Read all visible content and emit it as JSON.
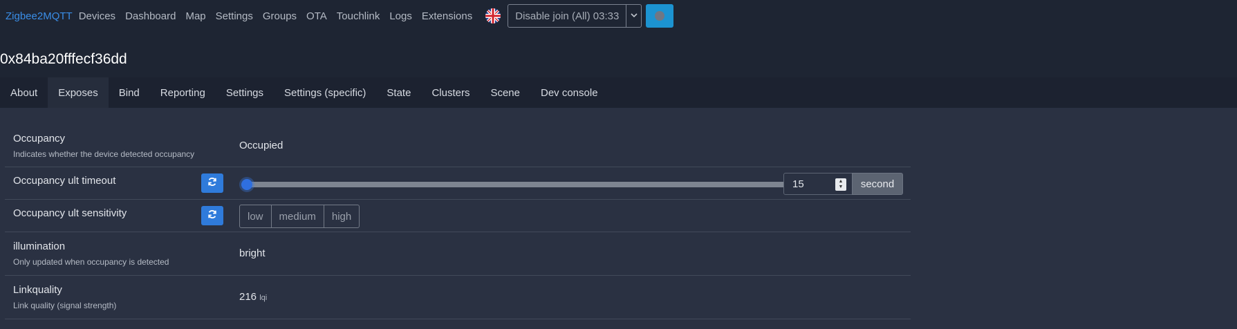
{
  "nav": {
    "brand": "Zigbee2MQTT",
    "links": [
      "Devices",
      "Dashboard",
      "Map",
      "Settings",
      "Groups",
      "OTA",
      "Touchlink",
      "Logs",
      "Extensions"
    ],
    "join_label": "Disable join (All) 03:33"
  },
  "device": {
    "title": "0x84ba20fffecf36dd"
  },
  "tabs": [
    "About",
    "Exposes",
    "Bind",
    "Reporting",
    "Settings",
    "Settings (specific)",
    "State",
    "Clusters",
    "Scene",
    "Dev console"
  ],
  "active_tab": "Exposes",
  "exposes": {
    "occupancy": {
      "title": "Occupancy",
      "description": "Indicates whether the device detected occupancy",
      "value": "Occupied"
    },
    "timeout": {
      "title": "Occupancy ult timeout",
      "value": "15",
      "slider_fraction": 0.0,
      "unit": "second"
    },
    "sensitivity": {
      "title": "Occupancy ult sensitivity",
      "options": [
        "low",
        "medium",
        "high"
      ]
    },
    "illumination": {
      "title": "illumination",
      "description": "Only updated when occupancy is detected",
      "value": "bright"
    },
    "linkquality": {
      "title": "Linkquality",
      "description": "Link quality (signal strength)",
      "value": "216",
      "unit": "lqi"
    }
  },
  "colors": {
    "accent": "#2f7bdb",
    "brand": "#3a8ee8",
    "status_button": "#1c93d1",
    "background": "#1e2533",
    "panel": "#2a3142"
  }
}
